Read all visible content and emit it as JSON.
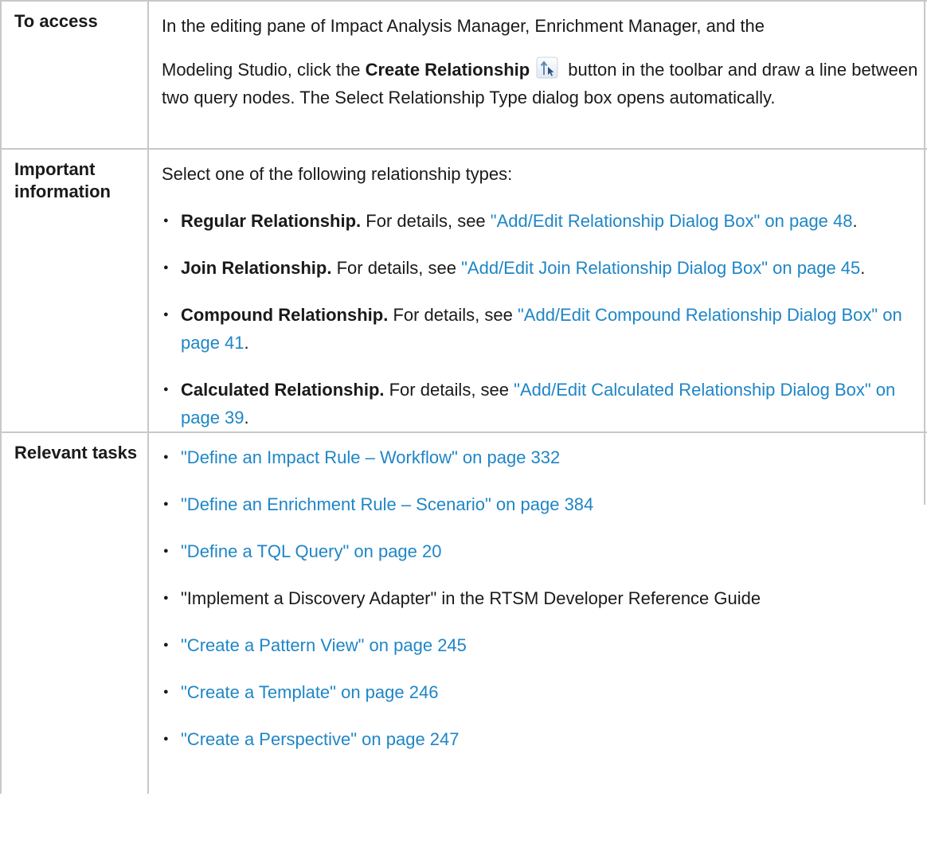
{
  "rows": {
    "access": {
      "label": "To access",
      "text_1": "In the editing pane of Impact Analysis Manager, Enrichment Manager, and the",
      "text_2": "Modeling Studio, click the ",
      "bold": "Create Relationship",
      "text_3": " button in the toolbar and draw a line between two query nodes. The Select Relationship Type dialog box opens automatically.",
      "icon": "create-relationship-icon"
    },
    "info": {
      "label": "Important information",
      "intro": "Select one of the following relationship types:",
      "items": [
        {
          "bold": "Regular Relationship.",
          "text": " For details, see ",
          "link": "\"Add/Edit Relationship Dialog Box\" on page 48",
          "end": "."
        },
        {
          "bold": "Join Relationship.",
          "text": " For details, see ",
          "link": "\"Add/Edit Join Relationship Dialog Box\" on page 45",
          "end": "."
        },
        {
          "bold": "Compound Relationship.",
          "text": " For details, see ",
          "link": "\"Add/Edit Compound Relationship Dialog Box\" on page 41",
          "end": "."
        },
        {
          "bold": "Calculated Relationship.",
          "text": " For details, see ",
          "link": "\"Add/Edit Calculated Relationship Dialog Box\" on page 39",
          "end": "."
        }
      ]
    },
    "tasks": {
      "label": "Relevant tasks",
      "items": [
        {
          "link": "\"Define an Impact Rule – Workflow\" on page 332"
        },
        {
          "link": "\"Define an Enrichment Rule – Scenario\" on page 384"
        },
        {
          "link": "\"Define a TQL Query\" on page 20"
        },
        {
          "text": "\"Implement a Discovery Adapter\" in the RTSM Developer Reference Guide"
        },
        {
          "link": "\"Create a Pattern View\" on page 245"
        },
        {
          "link": "\"Create a Template\" on page 246"
        },
        {
          "link": "\"Create a Perspective\" on page 247"
        }
      ]
    }
  },
  "colors": {
    "link": "#1f86c6",
    "border": "#c8c8c8",
    "text": "#1a1a1a"
  }
}
